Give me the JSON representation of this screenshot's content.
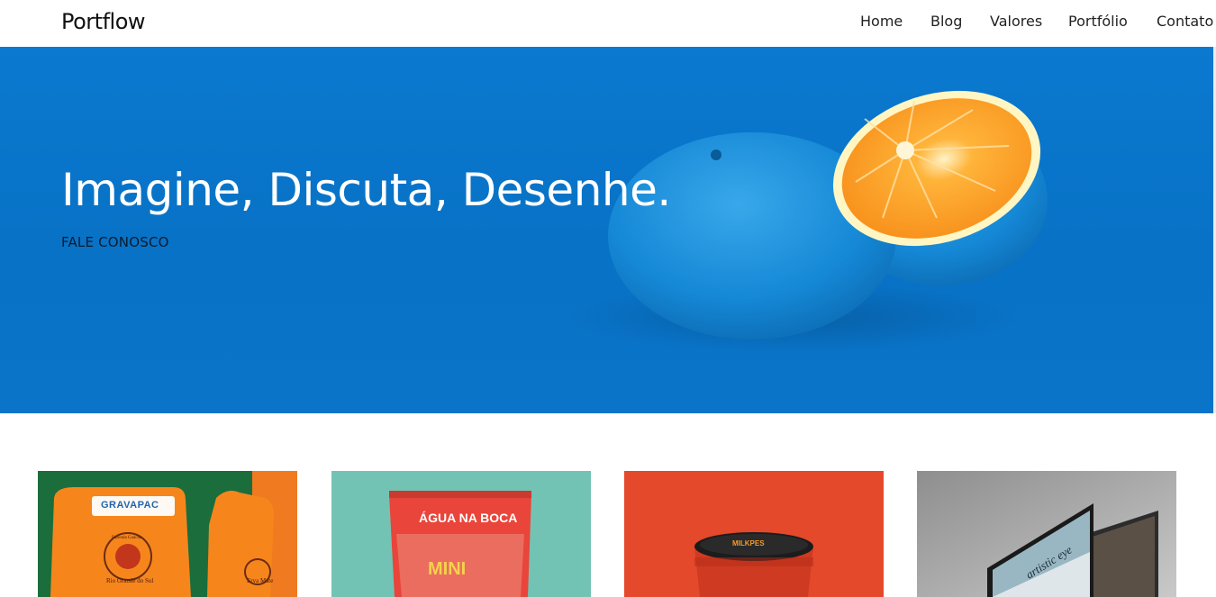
{
  "header": {
    "brand": "Portflow",
    "nav": [
      "Home",
      "Blog",
      "Valores",
      "Portfólio",
      "Contato"
    ]
  },
  "hero": {
    "title": "Imagine, Discuta, Desenhe.",
    "cta": "FALE CONOSCO"
  },
  "portfolio": {
    "items": [
      {
        "brand_text": "GRAVAPAC",
        "label_text": "Rio Grande do Sul",
        "bag_text": "Erva Mate",
        "seal_top": "Fazenda Gaúcha"
      },
      {
        "headline_text": "ÁGUA NA BOCA",
        "sub_text": "MINI"
      },
      {
        "lid_text": "MILKPES"
      },
      {
        "screen_text": "artistic eye"
      }
    ]
  },
  "colors": {
    "hero_blue": "#0a74c8",
    "orange": "#f6921e",
    "teal": "#73c3b4",
    "red_orange": "#e4492b"
  }
}
